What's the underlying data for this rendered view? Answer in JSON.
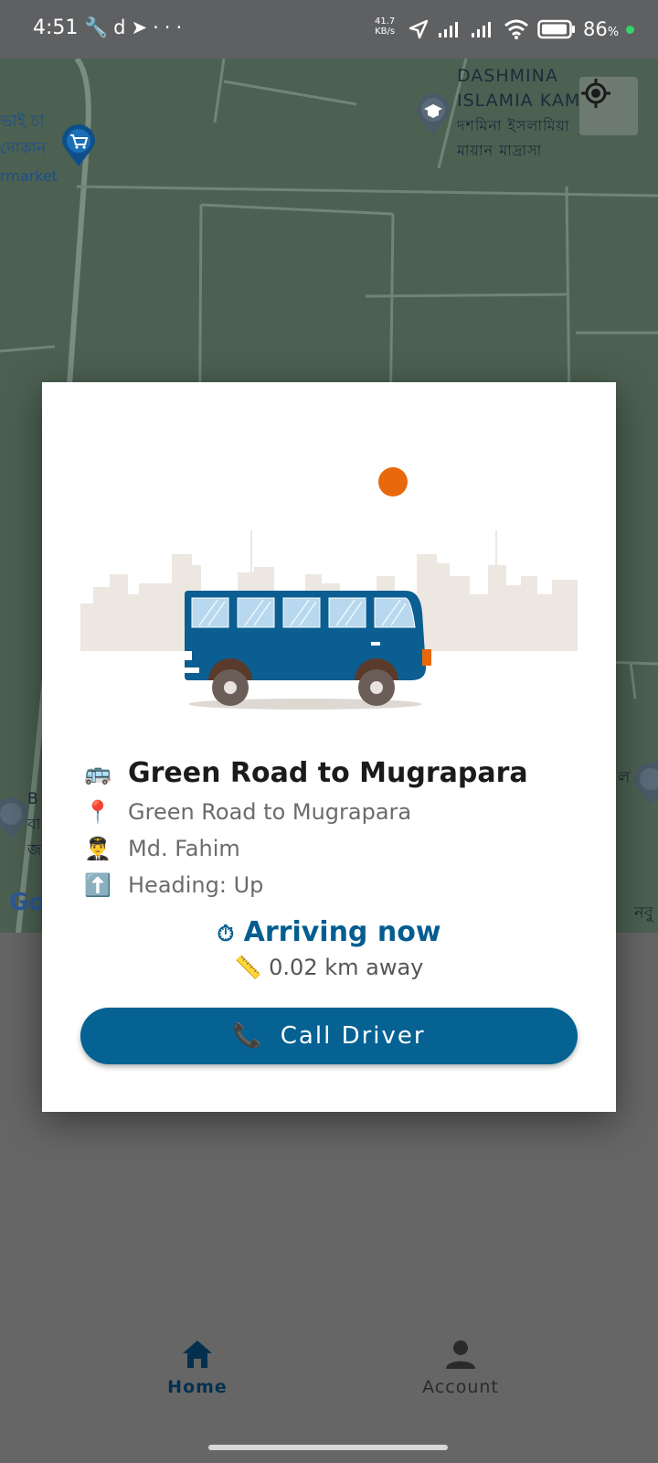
{
  "status_bar": {
    "time": "4:51",
    "icons": [
      "wrench-icon",
      "d-icon",
      "telegram-icon",
      "more-icon"
    ],
    "net_speed_value": "41.7",
    "net_speed_unit": "KB/s",
    "battery_percent": "86",
    "battery_unit": "%"
  },
  "map": {
    "labels": {
      "poi_1_line1": "DASHMINA",
      "poi_1_line2": "ISLAMIA KAMI",
      "poi_1_bn1": "দশমিনা ইসলামিয়া",
      "poi_1_bn2": "মায়ান মাদ্রাসা",
      "shop_line1": "ভাই চা",
      "shop_line2": "দোকান",
      "shop_line3": "rmarket",
      "left_edge_1": "B",
      "left_edge_2": "বা",
      "left_edge_3": "জ",
      "right_edge_1": "ল",
      "right_edge_2": "নবু",
      "google": "Go"
    },
    "colors": {
      "background": "#4d6152",
      "roads": "#6f8577"
    }
  },
  "dialog": {
    "route_title": "Green Road to Mugrapara",
    "route_icon": "🚌",
    "location": "Green Road to Mugrapara",
    "location_icon": "📍",
    "driver": "Md. Fahim",
    "driver_icon": "👨‍✈️",
    "heading": "Heading: Up",
    "heading_icon": "⬆️",
    "arrival_status": "Arriving now",
    "arrival_icon": "⏱",
    "distance": "0.02 km away",
    "distance_icon": "📏",
    "call_button_label": "Call Driver",
    "call_icon": "📞",
    "colors": {
      "accent": "#056292",
      "sun": "#e8680c",
      "bus": "#0a5e91",
      "skyline": "#ede7e2"
    }
  },
  "bottom_nav": {
    "items": [
      {
        "label": "Home",
        "icon": "home-icon",
        "active": true
      },
      {
        "label": "Account",
        "icon": "account-icon",
        "active": false
      }
    ]
  }
}
